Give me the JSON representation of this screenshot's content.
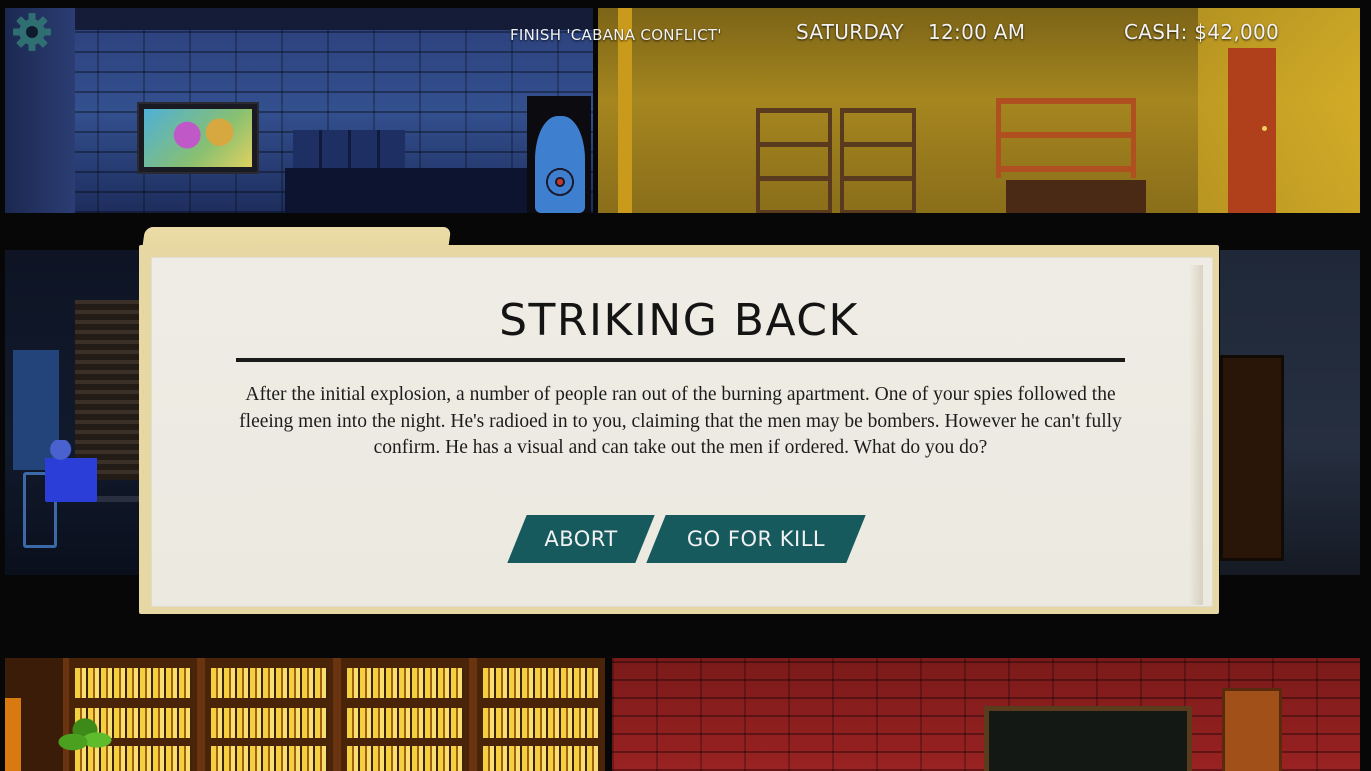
{
  "hud": {
    "objective": "FINISH 'CABANA CONFLICT'",
    "day": "SATURDAY",
    "time": "12:00 AM",
    "cash": "CASH: $42,000",
    "settings_icon": "gear-icon"
  },
  "dialog": {
    "title": "STRIKING BACK",
    "body": "After the initial explosion, a number of people ran out of the burning apartment. One of your spies followed the fleeing men into the night. He's radioed in to you, claiming that the men may be bombers. However he can't fully confirm. He has a visual and can take out the men if ordered. What do you do?",
    "actions": {
      "abort": "ABORT",
      "go_for_kill": "GO FOR KILL"
    }
  },
  "colors": {
    "button": "#175a5e",
    "paper": "#eeece4",
    "folder": "#e6d7a3",
    "gear": "#2f6f72"
  }
}
